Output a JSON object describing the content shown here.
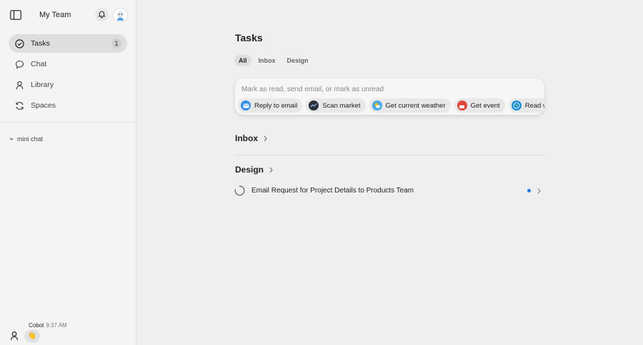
{
  "sidebar": {
    "team_name": "My Team",
    "nav": [
      {
        "label": "Tasks",
        "badge": "1",
        "icon": "check-circle-icon"
      },
      {
        "label": "Chat",
        "icon": "chat-bubble-icon"
      },
      {
        "label": "Library",
        "icon": "person-icon"
      },
      {
        "label": "Spaces",
        "icon": "refresh-icon"
      }
    ],
    "mini_chat_label": "mini chat",
    "last_message": {
      "sender": "Cobot",
      "time": "9:37 AM",
      "content": "👋"
    }
  },
  "main": {
    "title": "Tasks",
    "tabs": [
      {
        "label": "All",
        "active": true
      },
      {
        "label": "Inbox",
        "active": false
      },
      {
        "label": "Design",
        "active": false
      }
    ],
    "command": {
      "placeholder": "Mark as read, send email, or mark as unread",
      "chips": [
        {
          "label": "Reply to email",
          "icon": "mail-icon",
          "color": "#2f8ee8"
        },
        {
          "label": "Scan market",
          "icon": "globe-dark-icon",
          "color": "#2a2f3a"
        },
        {
          "label": "Get current weather",
          "icon": "weather-icon",
          "color": "#f4b400"
        },
        {
          "label": "Get event",
          "icon": "calendar-icon",
          "color": "#e0453a"
        },
        {
          "label": "Read web page",
          "icon": "globe-icon",
          "color": "#1e8fd8"
        }
      ]
    },
    "sections": {
      "inbox": "Inbox",
      "design": "Design"
    },
    "tasks": [
      {
        "title": "Email Request for Project Details to Products Team",
        "unread": true
      }
    ]
  },
  "colors": {
    "accent": "#1e78e6",
    "sidebar_bg": "#f4f4f4",
    "main_bg": "#efefef"
  }
}
